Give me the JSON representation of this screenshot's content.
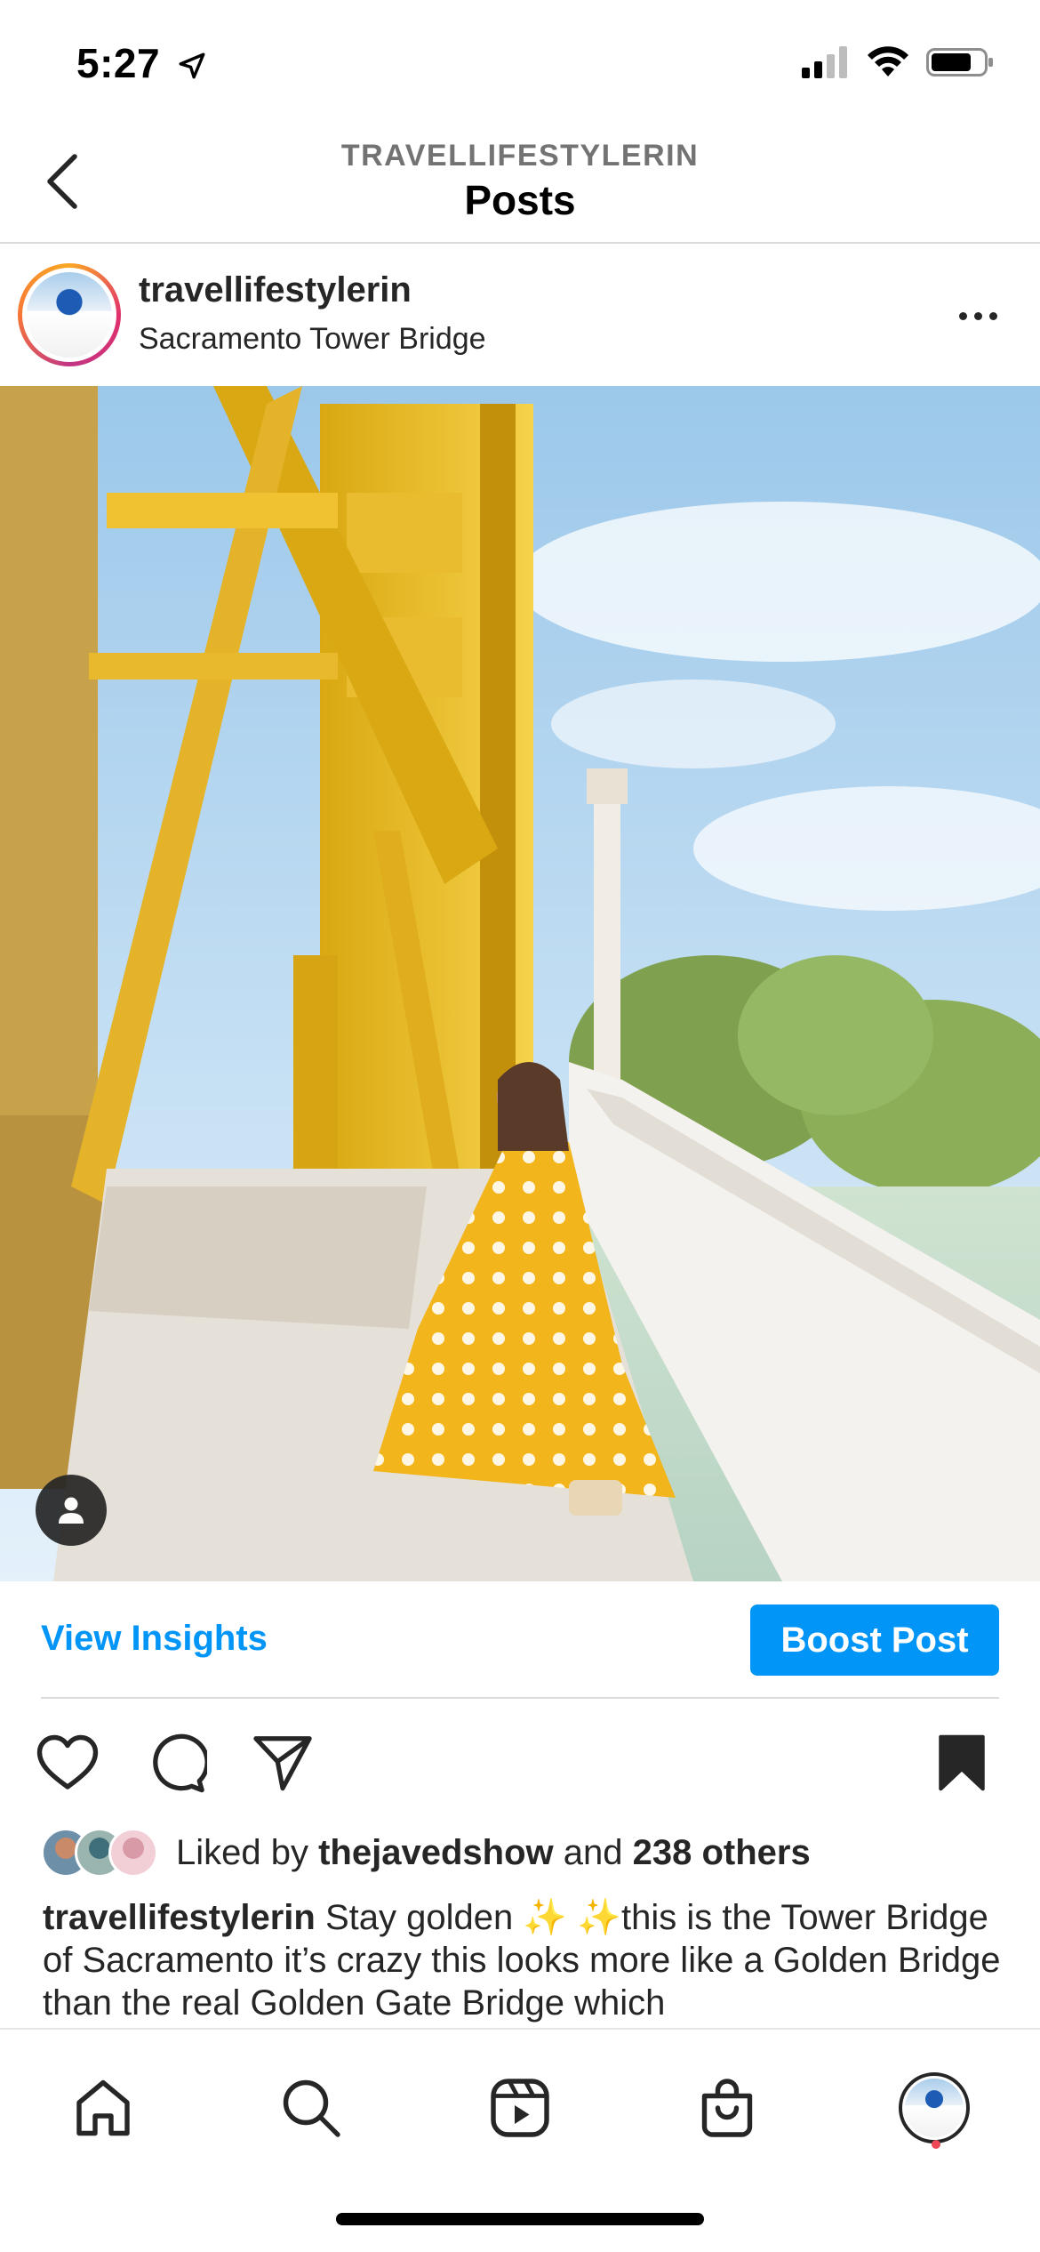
{
  "status_bar": {
    "time": "5:27"
  },
  "header": {
    "account": "TRAVELLIFESTYLERIN",
    "title": "Posts"
  },
  "post": {
    "username": "travellifestylerin",
    "location": "Sacramento Tower Bridge",
    "view_insights": "View Insights",
    "boost_post": "Boost Post",
    "likes_prefix": "Liked by ",
    "liked_by_user": "thejavedshow",
    "likes_and": " and ",
    "likes_others": "238 others",
    "caption_user": "travellifestylerin",
    "caption_text": " Stay golden ✨ ✨this is the Tower Bridge of Sacramento it’s crazy this looks more like a Golden Bridge than the real Golden Gate Bridge which"
  },
  "icons": {
    "back": "chevron-left-icon",
    "more": "more-horizontal-icon",
    "like": "heart-icon",
    "comment": "comment-icon",
    "share": "paper-plane-icon",
    "save": "bookmark-filled-icon",
    "tag": "person-icon",
    "tabs": [
      "home-icon",
      "search-icon",
      "reels-icon",
      "shop-icon",
      "profile-avatar"
    ]
  },
  "colors": {
    "accent": "#0095f6",
    "text": "#262626",
    "notification": "#ed4956"
  }
}
